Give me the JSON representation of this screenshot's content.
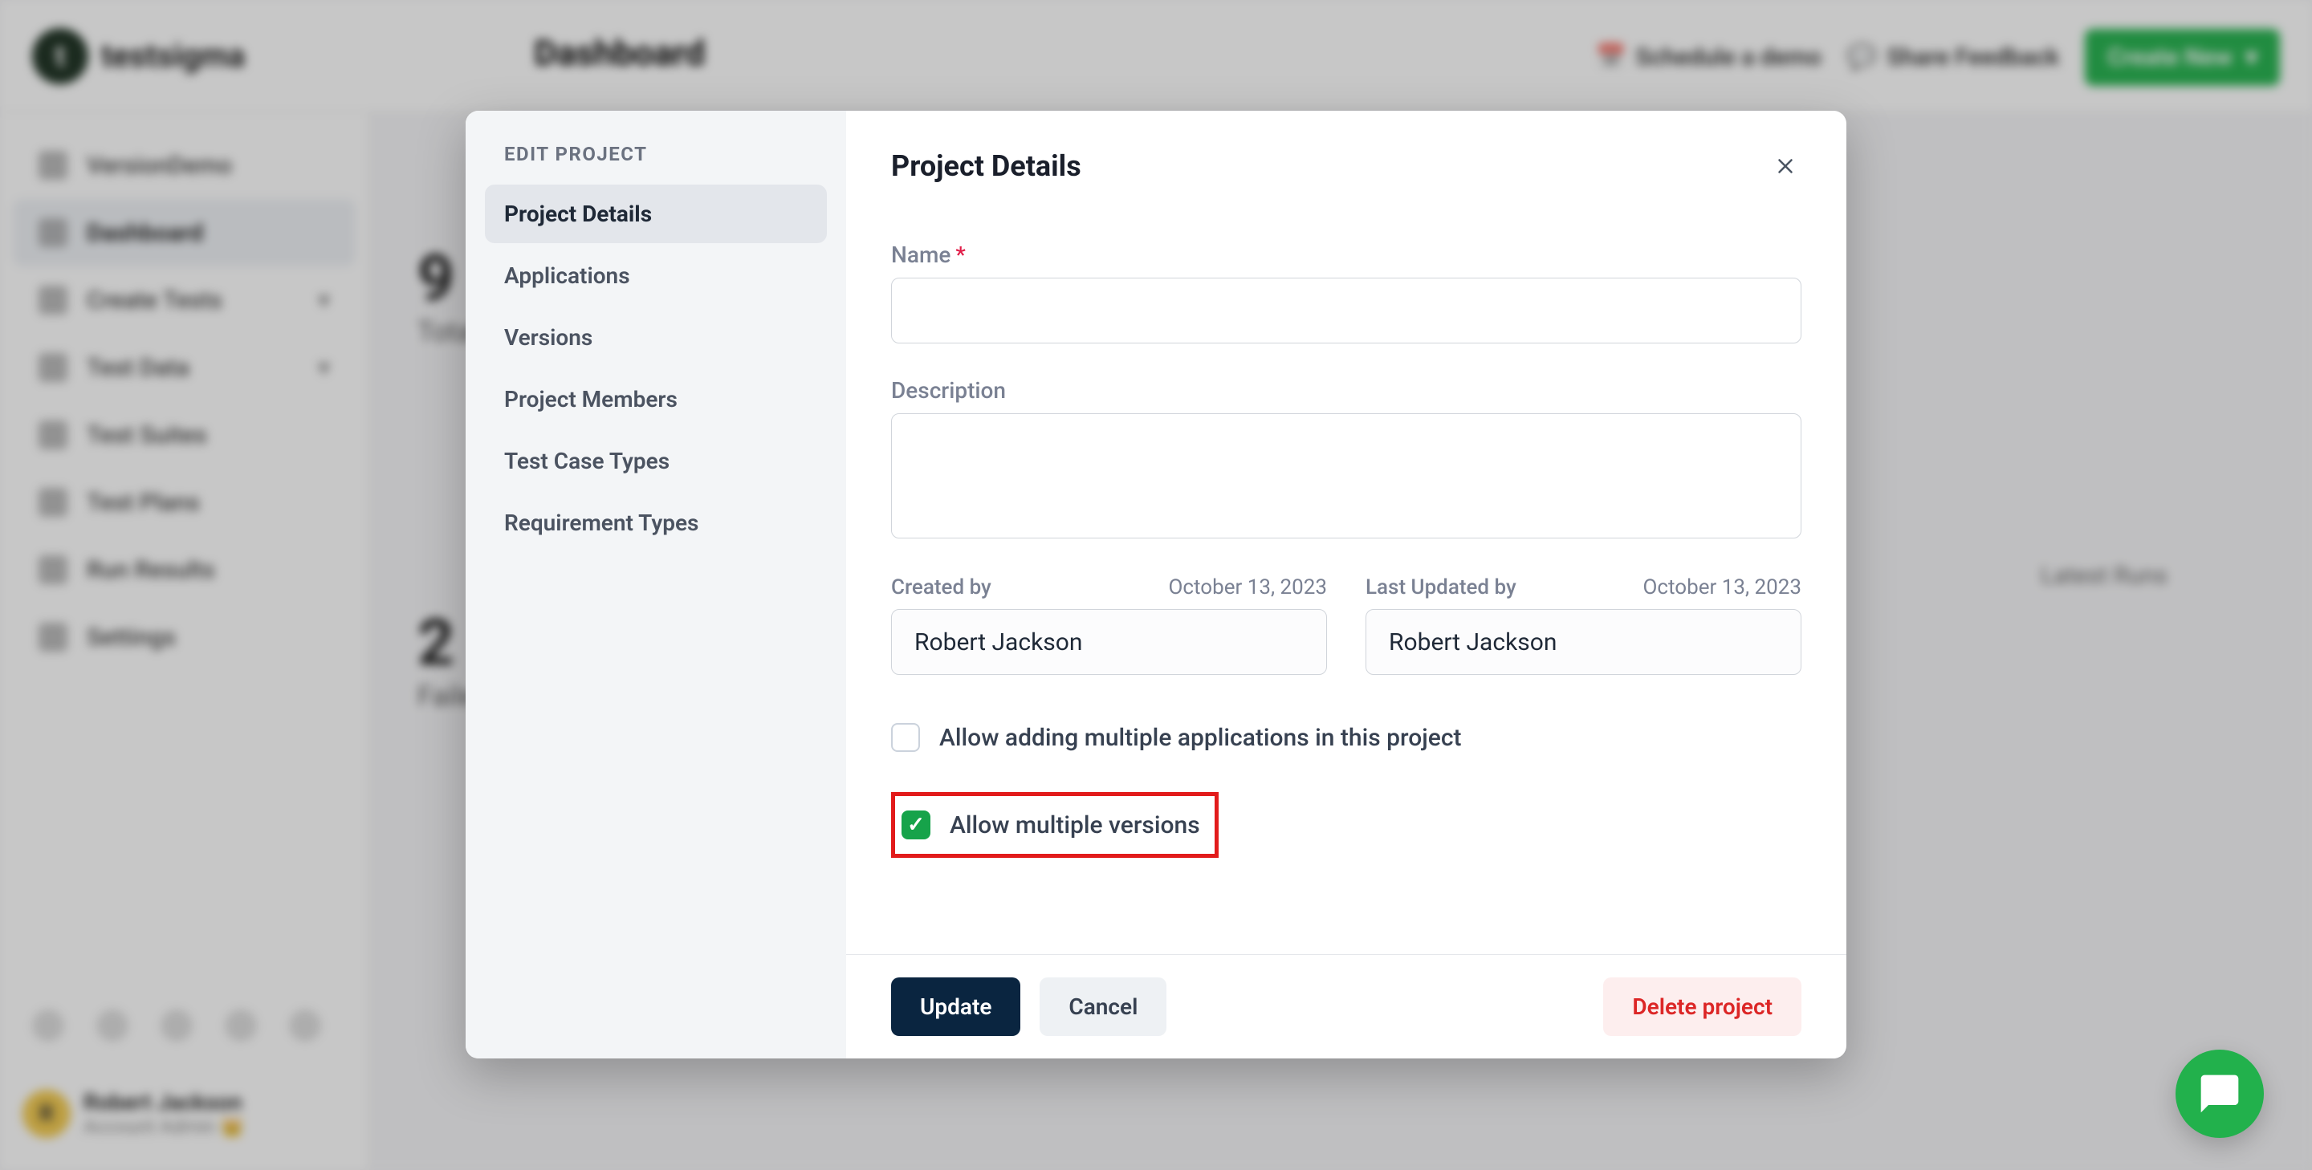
{
  "app": {
    "logo_text": "testsigma",
    "dashboard_heading": "Dashboard",
    "schedule_demo": "Schedule a demo",
    "share_feedback": "Share Feedback",
    "create_new": "Create New"
  },
  "sidebar_background": {
    "project_name": "VersionDemo",
    "items": [
      "Dashboard",
      "Create Tests",
      "Test Data",
      "Test Suites",
      "Test Plans",
      "Run Results",
      "Settings"
    ]
  },
  "stats": {
    "nine": "9",
    "nine_label": "Total",
    "two": "2",
    "two_label": "Failed",
    "latest_runs": "Latest Runs"
  },
  "user": {
    "initials": "R",
    "name": "Robert Jackson",
    "role": "Account Admin 👑"
  },
  "modal": {
    "edit_project_label": "Edit Project",
    "nav": {
      "project_details": "Project Details",
      "applications": "Applications",
      "versions": "Versions",
      "project_members": "Project Members",
      "test_case_types": "Test Case Types",
      "requirement_types": "Requirement Types"
    },
    "title": "Project Details",
    "fields": {
      "name_label": "Name",
      "name_value": "",
      "description_label": "Description",
      "description_value": ""
    },
    "meta": {
      "created_by_label": "Created by",
      "created_by_date": "October 13, 2023",
      "created_by_value": "Robert Jackson",
      "updated_by_label": "Last Updated by",
      "updated_by_date": "October 13, 2023",
      "updated_by_value": "Robert Jackson"
    },
    "checkboxes": {
      "allow_multi_apps": "Allow adding multiple applications in this project",
      "allow_multi_versions": "Allow multiple versions"
    },
    "footer": {
      "update": "Update",
      "cancel": "Cancel",
      "delete": "Delete project"
    }
  }
}
